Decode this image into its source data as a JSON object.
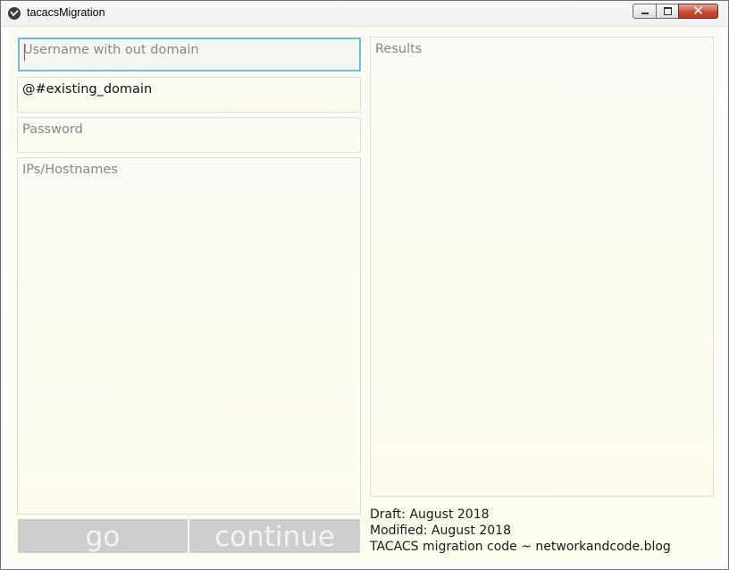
{
  "window": {
    "title": "tacacsMigration",
    "controls": {
      "close_glyph": "✕"
    }
  },
  "form": {
    "username": {
      "value": "",
      "placeholder": "Username with out domain"
    },
    "domain": {
      "value": "@#existing_domain"
    },
    "password": {
      "value": "",
      "placeholder": "Password"
    },
    "hosts": {
      "value": "",
      "placeholder": "IPs/Hostnames"
    },
    "results": {
      "value": "",
      "placeholder": "Results"
    }
  },
  "buttons": {
    "go_label": "go",
    "continue_label": "continue"
  },
  "footer": {
    "draft": "Draft: August 2018",
    "modified": "Modified: August 2018",
    "credit": "TACACS migration code ~ networkandcode.blog"
  },
  "colors": {
    "focus_border": "#73bcd6",
    "button_bg": "#cdcdcd",
    "close_button": "#c44a34"
  }
}
